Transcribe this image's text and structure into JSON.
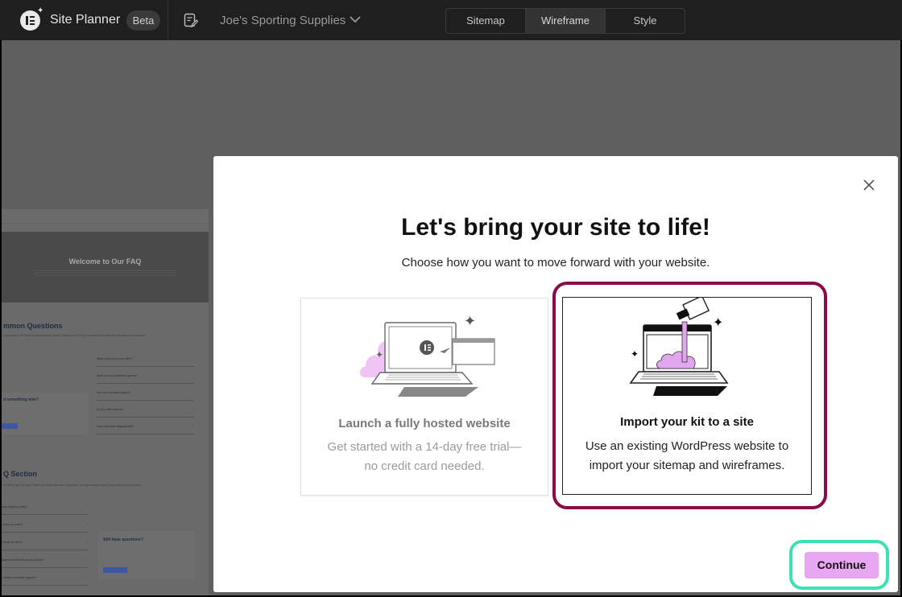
{
  "topbar": {
    "app_title": "Site Planner",
    "badge": "Beta",
    "site_name": "Joe's Sporting Supplies",
    "tabs": [
      {
        "label": "Sitemap",
        "active": false
      },
      {
        "label": "Wireframe",
        "active": true
      },
      {
        "label": "Style",
        "active": false
      }
    ]
  },
  "wireframe": {
    "hero_title": "Welcome to Our FAQ",
    "section1_title": "mmon Questions",
    "section1_intro": "e you asked. We have the answers you need. Check out our FAQs to learn more about our products and services.",
    "questions": [
      "What products do you offer?",
      "What are your payment options?",
      "How can I contact support?",
      "Do you offer refunds?",
      "How long does shipping take?"
    ],
    "side_title": "d something else?",
    "section2_title": "Q Section",
    "section2_intro": "e? We're here to help! Check our frequently asked questions for clear answers about our policies and products.",
    "faq_items": [
      "your shipping policy?",
      "I track my order?",
      "I return an item?",
      "payment methods do you accept?",
      "I contact customer support?"
    ],
    "help_title": "Still have questions?",
    "help_button": "Contact Team"
  },
  "modal": {
    "title": "Let's bring your site to life!",
    "subtitle": "Choose how you want to move forward with your website.",
    "option_hosted": {
      "title": "Launch a fully hosted website",
      "desc_line1": "Get started with a 14-day free trial—",
      "desc_line2": "no credit card needed."
    },
    "option_import": {
      "title": "Import your kit to a site",
      "desc_line1": "Use an existing WordPress website to",
      "desc_line2": "import your sitemap and wireframes."
    },
    "continue_label": "Continue"
  },
  "colors": {
    "highlight_selected": "#8a0b4a",
    "highlight_continue": "#3fe0b6",
    "continue_bg": "#e9a6f2",
    "illustration_pink": "#e2a6f0"
  }
}
